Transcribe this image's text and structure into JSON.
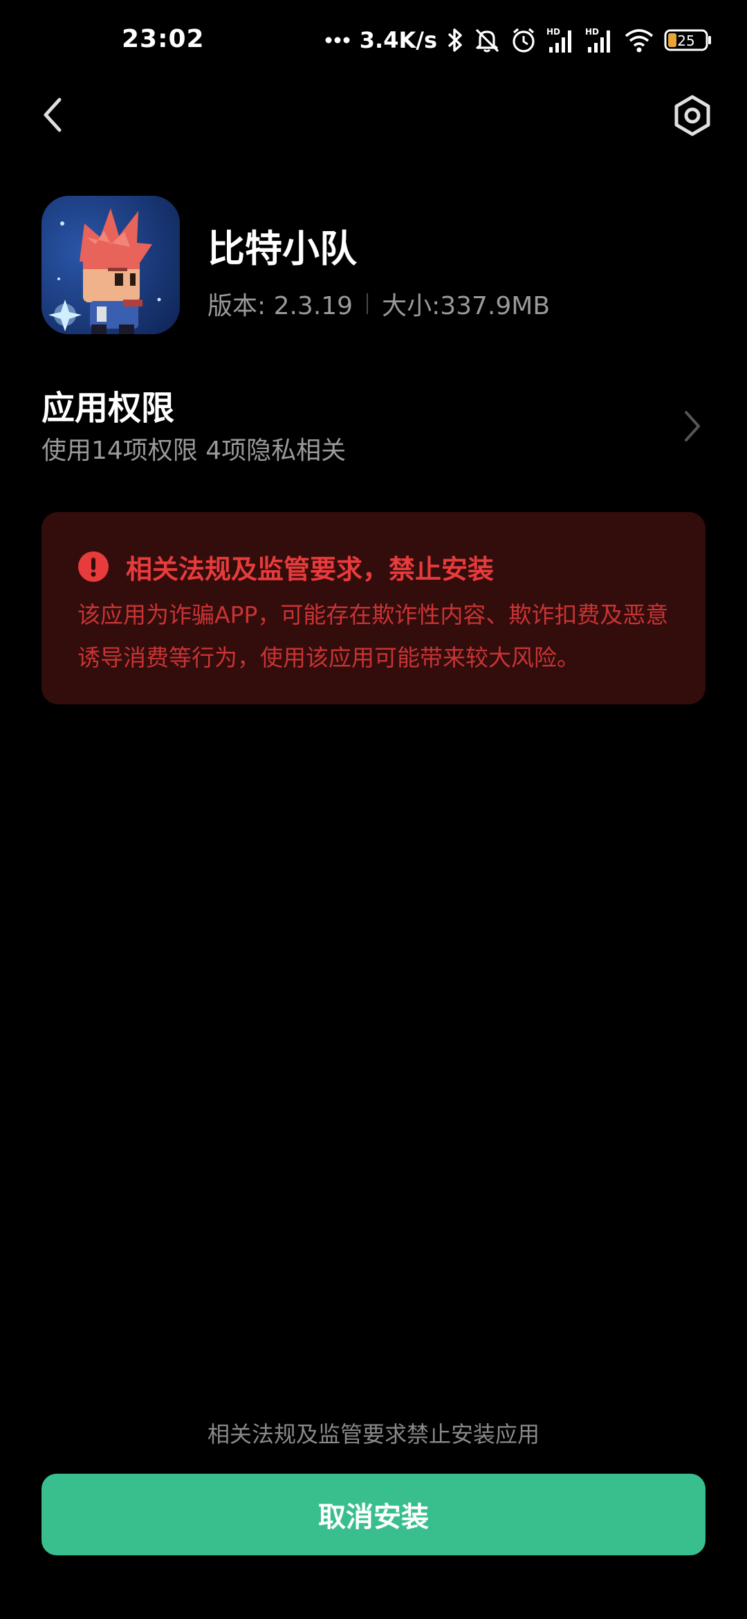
{
  "status_bar": {
    "time": "23:02",
    "net_speed": "3.4K/s",
    "battery": "25",
    "signal_1_label": "HD",
    "signal_2_label": "HD",
    "icons": [
      "more-dots-icon",
      "bluetooth-icon",
      "mute-icon",
      "alarm-icon",
      "signal-icon",
      "signal-icon",
      "wifi-icon",
      "battery-icon"
    ]
  },
  "top_bar": {
    "back_icon": "chevron-left-icon",
    "settings_icon": "hexagon-settings-icon"
  },
  "app": {
    "name": "比特小队",
    "version": "版本: 2.3.19",
    "size": "大小:337.9MB"
  },
  "permissions": {
    "title": "应用权限",
    "subtitle": "使用14项权限 4项隐私相关"
  },
  "warning": {
    "title": "相关法规及监管要求，禁止安装",
    "body": "该应用为诈骗APP，可能存在欺诈性内容、欺诈扣费及恶意诱导消费等行为，使用该应用可能带来较大风险。",
    "color_title": "#e83b3b",
    "color_bg": "#330c0c"
  },
  "footer": {
    "hint": "相关法规及监管要求禁止安装应用",
    "cancel_label": "取消安装",
    "button_color": "#39bf8e"
  }
}
